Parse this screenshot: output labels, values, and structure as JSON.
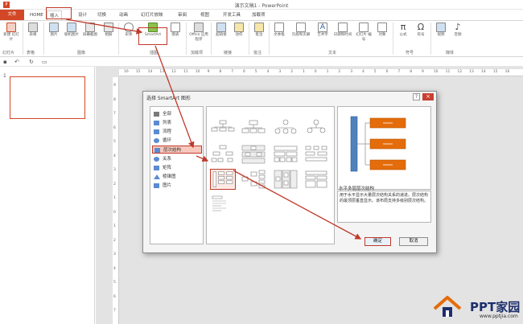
{
  "window": {
    "title": "演示文稿1 - PowerPoint"
  },
  "tabs": [
    "文件",
    "HOME",
    "插入",
    "设计",
    "切换",
    "动画",
    "幻灯片放映",
    "审阅",
    "视图",
    "开发工具",
    "加载项"
  ],
  "ribbon": {
    "buttons": [
      {
        "label": "新建\n幻灯片"
      },
      {
        "label": "表格"
      },
      {
        "label": "图片"
      },
      {
        "label": "联机图片"
      },
      {
        "label": "屏幕截图"
      },
      {
        "label": "相册"
      },
      {
        "label": "形状"
      },
      {
        "label": "SmartArt"
      },
      {
        "label": "图表"
      },
      {
        "label": "Office\n应用程序"
      },
      {
        "label": "超链接"
      },
      {
        "label": "动作"
      },
      {
        "label": "批注"
      },
      {
        "label": "文本框"
      },
      {
        "label": "页眉和页脚"
      },
      {
        "label": "艺术字"
      },
      {
        "label": "日期和时间"
      },
      {
        "label": "幻灯片\n编号"
      },
      {
        "label": "对象"
      },
      {
        "label": "公式"
      },
      {
        "label": "符号"
      },
      {
        "label": "视频"
      },
      {
        "label": "音频"
      }
    ],
    "groups": [
      "幻灯片",
      "表格",
      "图像",
      "插图",
      "加载项",
      "链接",
      "批注",
      "文本",
      "符号",
      "媒体"
    ]
  },
  "slides": {
    "current_number": "1"
  },
  "ruler": {
    "h_ticks": [
      "16",
      "15",
      "14",
      "13",
      "12",
      "11",
      "10",
      "9",
      "8",
      "7",
      "6",
      "5",
      "4",
      "3",
      "2",
      "1",
      "0",
      "1",
      "2",
      "3",
      "4",
      "5",
      "6",
      "7",
      "8",
      "9",
      "10",
      "11",
      "12",
      "13",
      "14",
      "15",
      "16"
    ],
    "v_ticks": [
      "9",
      "8",
      "7",
      "6",
      "5",
      "4",
      "3",
      "2",
      "1",
      "0",
      "1",
      "2",
      "3",
      "4",
      "5",
      "6",
      "7"
    ]
  },
  "dialog": {
    "title": "选择 SmartArt 图形",
    "help": "?",
    "close": "×",
    "categories": [
      {
        "label": "全部",
        "icon": "all-icon",
        "color": "#7a7a7a"
      },
      {
        "label": "列表",
        "icon": "list-icon",
        "color": "#5b8bd0"
      },
      {
        "label": "流程",
        "icon": "process-icon",
        "color": "#5b8bd0"
      },
      {
        "label": "循环",
        "icon": "cycle-icon",
        "color": "#5b8bd0"
      },
      {
        "label": "层次结构",
        "icon": "hierarchy-icon",
        "color": "#5b8bd0"
      },
      {
        "label": "关系",
        "icon": "relationship-icon",
        "color": "#5b8bd0"
      },
      {
        "label": "矩阵",
        "icon": "matrix-icon",
        "color": "#5b8bd0"
      },
      {
        "label": "棱锥图",
        "icon": "pyramid-icon",
        "color": "#5b8bd0"
      },
      {
        "label": "图片",
        "icon": "picture-icon",
        "color": "#5b8bd0"
      }
    ],
    "selected_category": "层次结构",
    "preview_name": "水平多层层次结构",
    "description": "用于水平显示大量层次结构关系的递进。层次结构的最顶层垂直显示。该布局支持多级别层次结构。",
    "ok_label": "确定",
    "cancel_label": "取消"
  },
  "logo": {
    "text": "PPT家园",
    "url": "www.pptjia.com"
  },
  "colors": {
    "accent": "#d24726",
    "highlight": "#c0392b",
    "smartart": "#e46c0a",
    "preview_blue": "#4f81bd"
  }
}
